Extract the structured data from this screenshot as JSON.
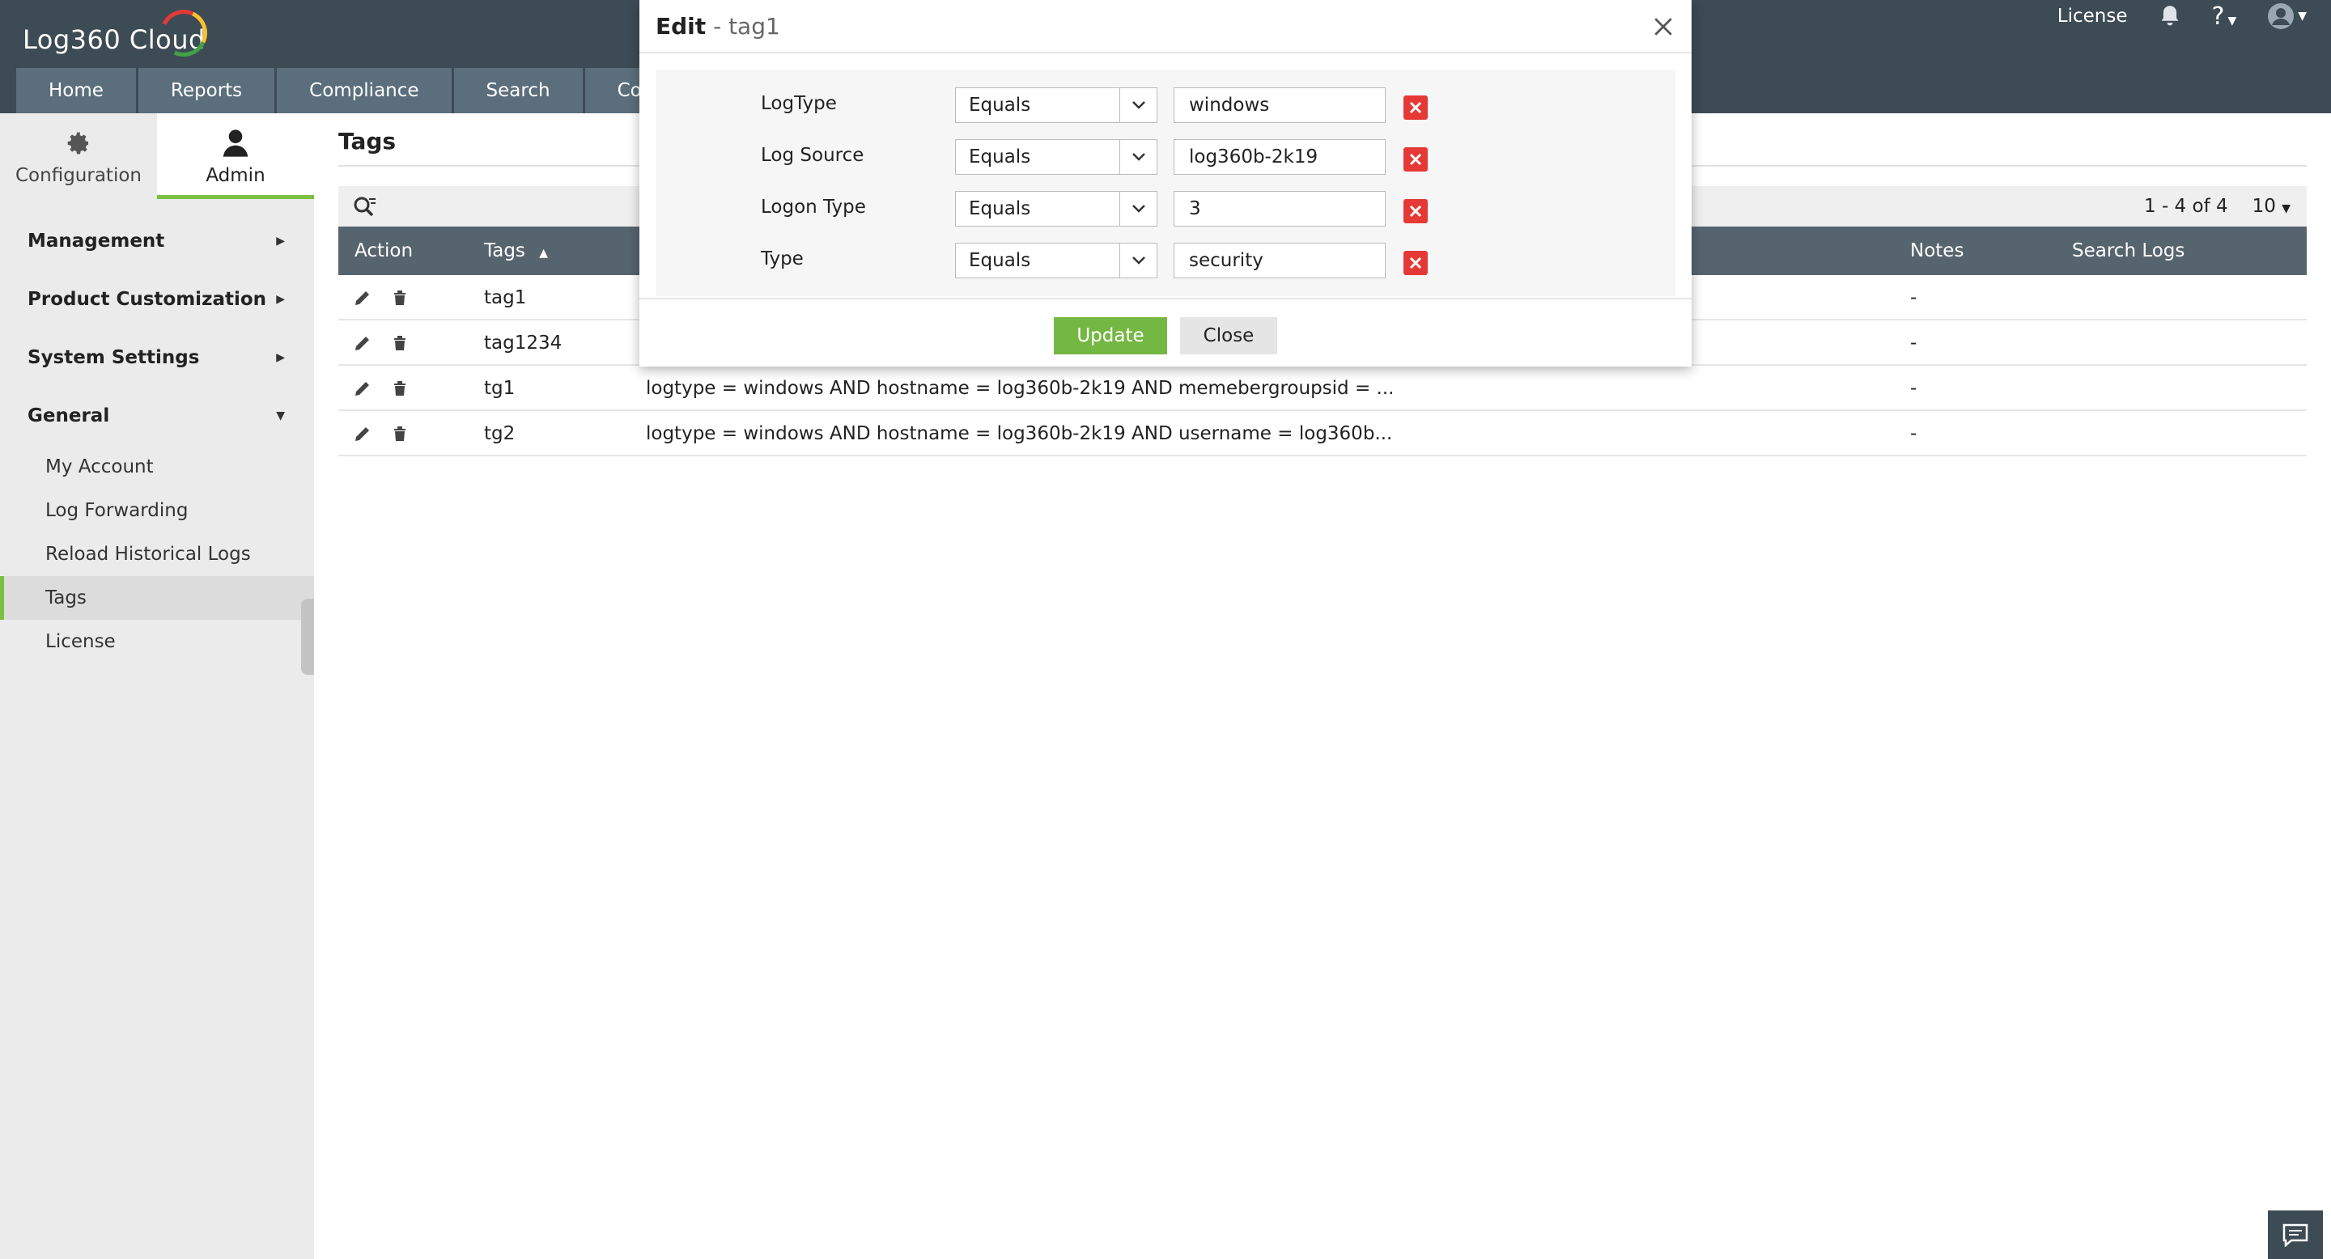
{
  "app": {
    "logo": "Log360 Cloud"
  },
  "nav": {
    "tabs": [
      "Home",
      "Reports",
      "Compliance",
      "Search",
      "Corr"
    ]
  },
  "topright": {
    "license": "License"
  },
  "sidebar": {
    "tabs": [
      {
        "label": "Configuration",
        "icon": "gear-icon"
      },
      {
        "label": "Admin",
        "icon": "user-icon"
      }
    ],
    "sections": [
      "Management",
      "Product Customization",
      "System Settings",
      "General"
    ],
    "general_items": [
      "My Account",
      "Log Forwarding",
      "Reload Historical Logs",
      "Tags",
      "License"
    ]
  },
  "main": {
    "title": "Tags",
    "pager": {
      "range": "1 - 4 of 4",
      "per_page": "10"
    },
    "columns": {
      "action": "Action",
      "tags": "Tags",
      "notes": "Notes",
      "search_logs": "Search Logs"
    },
    "rows": [
      {
        "tag": "tag1",
        "criteria": "",
        "notes": "-"
      },
      {
        "tag": "tag1234",
        "criteria": "",
        "notes": "-"
      },
      {
        "tag": "tg1",
        "criteria": "logtype = windows AND hostname = log360b-2k19 AND memebergroupsid = ...",
        "notes": "-"
      },
      {
        "tag": "tg2",
        "criteria": "logtype = windows AND hostname = log360b-2k19 AND username = log360b...",
        "notes": "-"
      }
    ]
  },
  "modal": {
    "title": "Edit",
    "subtitle": "- tag1",
    "criteria": [
      {
        "field": "LogType",
        "operator": "Equals",
        "value": "windows"
      },
      {
        "field": "Log Source",
        "operator": "Equals",
        "value": "log360b-2k19"
      },
      {
        "field": "Logon Type",
        "operator": "Equals",
        "value": "3"
      },
      {
        "field": "Type",
        "operator": "Equals",
        "value": "security"
      }
    ],
    "update_label": "Update",
    "close_label": "Close"
  },
  "colors": {
    "accent": "#7ac043",
    "header": "#3d4b55",
    "nav_tab": "#5b6e7c",
    "delete": "#e53935"
  }
}
